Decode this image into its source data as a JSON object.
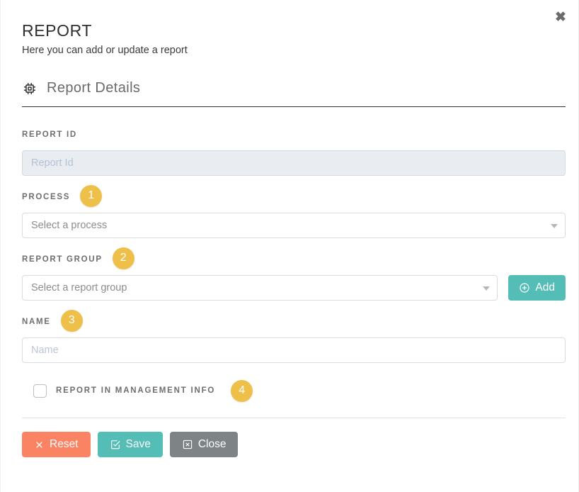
{
  "modal": {
    "close_icon": "close-x-icon",
    "title": "REPORT",
    "subtitle": "Here you can add or update a report"
  },
  "section": {
    "icon": "microchip-icon",
    "title": "Report Details"
  },
  "fields": {
    "report_id": {
      "label": "REPORT ID",
      "placeholder": "Report Id",
      "value": "",
      "disabled": true
    },
    "process": {
      "label": "PROCESS",
      "badge": "1",
      "placeholder": "Select a process",
      "value": "",
      "caret_icon": "chevron-down-icon"
    },
    "report_group": {
      "label": "REPORT GROUP",
      "badge": "2",
      "placeholder": "Select a report group",
      "value": "",
      "caret_icon": "chevron-down-icon",
      "add_button": {
        "label": "Add",
        "icon": "plus-circle-icon"
      }
    },
    "name": {
      "label": "NAME",
      "badge": "3",
      "placeholder": "Name",
      "value": ""
    },
    "management_info": {
      "label": "REPORT IN MANAGEMENT INFO",
      "badge": "4",
      "checked": false
    }
  },
  "footer": {
    "reset": {
      "label": "Reset",
      "icon": "x-icon"
    },
    "save": {
      "label": "Save",
      "icon": "check-square-icon"
    },
    "close": {
      "label": "Close",
      "icon": "x-square-icon"
    }
  },
  "colors": {
    "badge_gold": "#eec04a",
    "teal": "#54bdb6",
    "salmon": "#fa8363",
    "grey": "#7e8386",
    "disabled_bg": "#e9edf2"
  }
}
